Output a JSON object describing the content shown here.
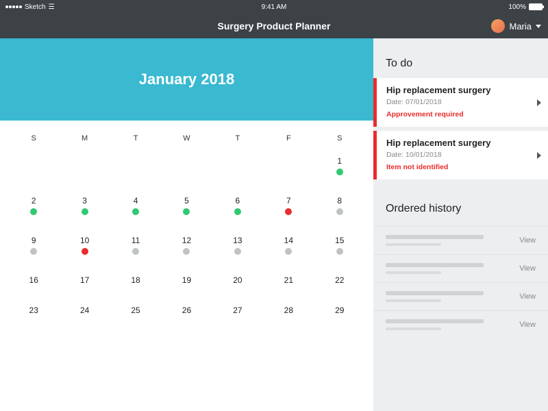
{
  "status": {
    "carrier": "Sketch",
    "time": "9:41 AM",
    "battery": "100%"
  },
  "header": {
    "title": "Surgery Product Planner",
    "user_name": "Maria"
  },
  "calendar": {
    "title": "January 2018",
    "weekdays": [
      "S",
      "M",
      "T",
      "W",
      "T",
      "F",
      "S"
    ],
    "rows": [
      [
        {
          "n": ""
        },
        {
          "n": ""
        },
        {
          "n": ""
        },
        {
          "n": ""
        },
        {
          "n": ""
        },
        {
          "n": ""
        },
        {
          "n": "1",
          "dot": "green"
        }
      ],
      [
        {
          "n": "2",
          "dot": "green"
        },
        {
          "n": "3",
          "dot": "green"
        },
        {
          "n": "4",
          "dot": "green"
        },
        {
          "n": "5",
          "dot": "green"
        },
        {
          "n": "6",
          "dot": "green"
        },
        {
          "n": "7",
          "dot": "red"
        },
        {
          "n": "8",
          "dot": "gray"
        }
      ],
      [
        {
          "n": "9",
          "dot": "gray"
        },
        {
          "n": "10",
          "dot": "red"
        },
        {
          "n": "11",
          "dot": "gray"
        },
        {
          "n": "12",
          "dot": "gray"
        },
        {
          "n": "13",
          "dot": "gray"
        },
        {
          "n": "14",
          "dot": "gray"
        },
        {
          "n": "15",
          "dot": "gray"
        }
      ],
      [
        {
          "n": "16"
        },
        {
          "n": "17"
        },
        {
          "n": "18"
        },
        {
          "n": "19"
        },
        {
          "n": "20"
        },
        {
          "n": "21"
        },
        {
          "n": "22"
        }
      ],
      [
        {
          "n": "23"
        },
        {
          "n": "24"
        },
        {
          "n": "25"
        },
        {
          "n": "26"
        },
        {
          "n": "27"
        },
        {
          "n": "28"
        },
        {
          "n": "29"
        }
      ]
    ]
  },
  "todo": {
    "title": "To do",
    "items": [
      {
        "title": "Hip replacement surgery",
        "date_label": "Date: 07/01/2018",
        "alert": "Approvement required"
      },
      {
        "title": "Hip replacement surgery",
        "date_label": "Date: 10/01/2018",
        "alert": "Item not identified"
      }
    ]
  },
  "history": {
    "title": "Ordered history",
    "view_label": "View",
    "count": 4
  }
}
